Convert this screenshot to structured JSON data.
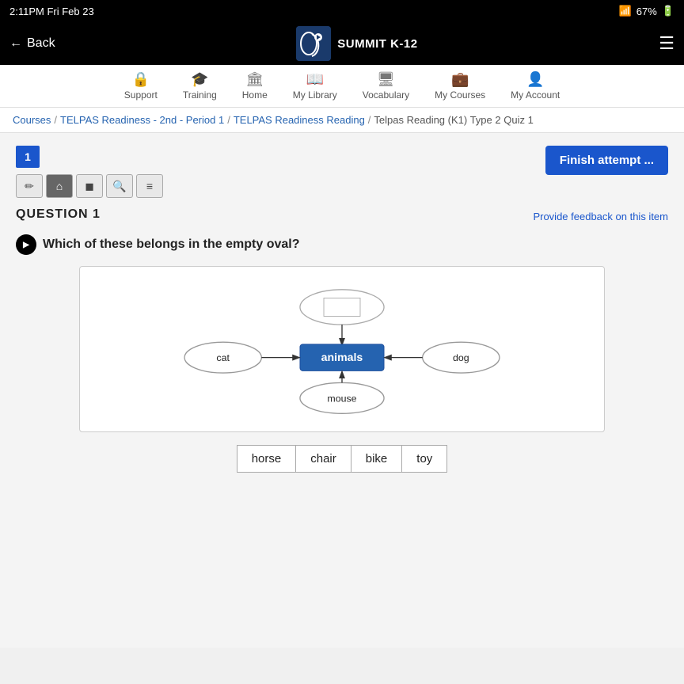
{
  "status_bar": {
    "time": "2:11PM",
    "date": "Fri Feb 23",
    "wifi": "WiFi",
    "battery": "67%"
  },
  "top_nav": {
    "back_label": "Back",
    "logo_text": "SUMMIT K-12",
    "hamburger_label": "Menu"
  },
  "second_nav": {
    "items": [
      {
        "id": "support",
        "icon": "🔒",
        "label": "Support"
      },
      {
        "id": "training",
        "icon": "🎓",
        "label": "Training"
      },
      {
        "id": "home",
        "icon": "🏛",
        "label": "Home"
      },
      {
        "id": "my-library",
        "icon": "📖",
        "label": "My Library"
      },
      {
        "id": "vocabulary",
        "icon": "🖥",
        "label": "Vocabulary"
      },
      {
        "id": "my-courses",
        "icon": "💼",
        "label": "My Courses"
      },
      {
        "id": "my-account",
        "icon": "👤",
        "label": "My Account"
      }
    ]
  },
  "breadcrumb": {
    "items": [
      {
        "label": "Courses",
        "link": true
      },
      {
        "label": "TELPAS Readiness - 2nd - Period 1",
        "link": true
      },
      {
        "label": "TELPAS Readiness Reading",
        "link": true
      },
      {
        "label": "Telpas Reading (K1) Type 2 Quiz 1",
        "link": false
      }
    ]
  },
  "quiz": {
    "page_number": "1",
    "finish_button": "Finish attempt ...",
    "tools": [
      {
        "icon": "✏",
        "id": "pencil",
        "active": false
      },
      {
        "icon": "⌂",
        "id": "home",
        "active": true
      },
      {
        "icon": "◼",
        "id": "box",
        "active": false
      },
      {
        "icon": "🔍",
        "id": "zoom",
        "active": false
      },
      {
        "icon": "≡",
        "id": "menu",
        "active": false
      }
    ],
    "question_label": "QUESTION 1",
    "feedback_link": "Provide feedback on this item",
    "question_text": "Which of these belongs in the empty oval?",
    "diagram": {
      "center_label": "animals",
      "left_label": "cat",
      "right_label": "dog",
      "bottom_label": "mouse",
      "top_label": ""
    },
    "choices": [
      {
        "id": "horse",
        "label": "horse"
      },
      {
        "id": "chair",
        "label": "chair"
      },
      {
        "id": "bike",
        "label": "bike"
      },
      {
        "id": "toy",
        "label": "toy"
      }
    ]
  }
}
